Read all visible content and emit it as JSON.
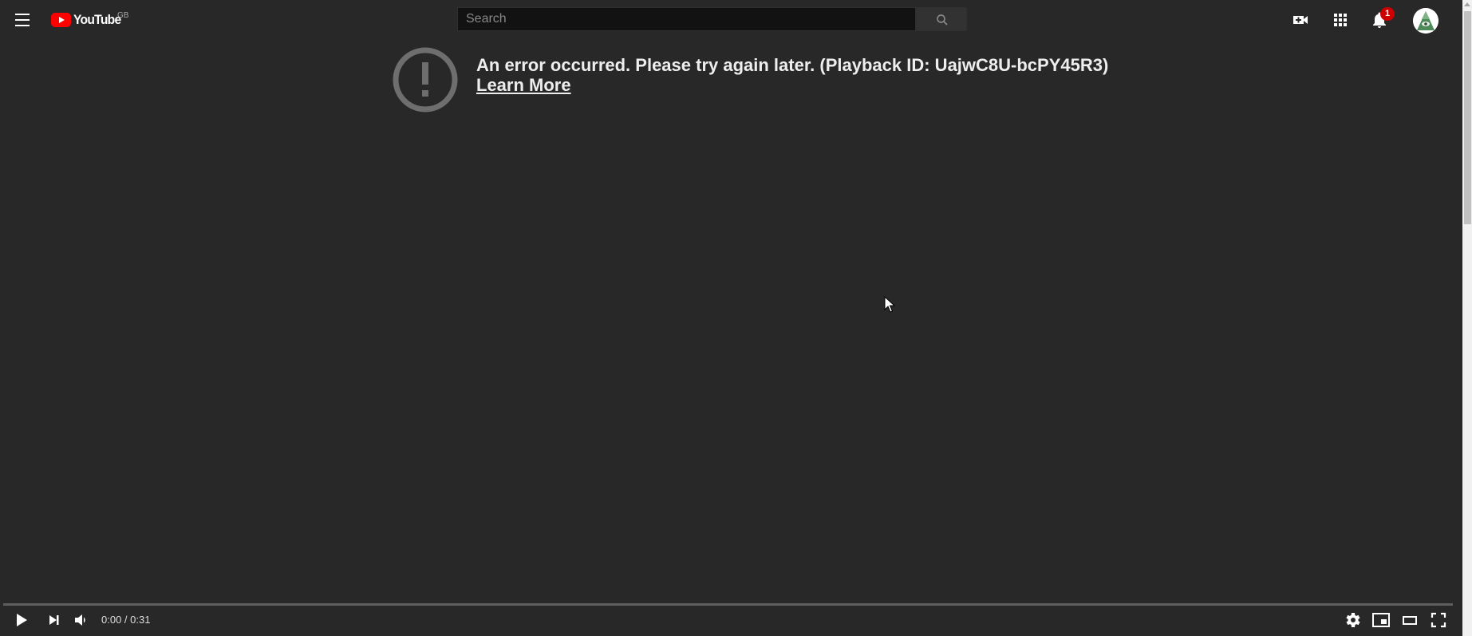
{
  "header": {
    "logo_text": "YouTube",
    "region": "GB",
    "search": {
      "placeholder": "Search",
      "value": ""
    },
    "notification_count": "1",
    "icons": [
      "menu-icon",
      "search-icon",
      "create-video-icon",
      "apps-icon",
      "notifications-icon",
      "avatar"
    ]
  },
  "player": {
    "error": {
      "message": "An error occurred. Please try again later. (Playback ID: UajwC8U-bcPY45R3)",
      "link": "Learn More"
    },
    "controls": {
      "current_time": "0:00",
      "duration": "0:31",
      "time_display": "0:00 / 0:31",
      "progress": 0
    }
  },
  "colors": {
    "background": "#282828",
    "brand_red": "#ff0000",
    "badge_red": "#cc0000",
    "text": "#eeeeee"
  }
}
